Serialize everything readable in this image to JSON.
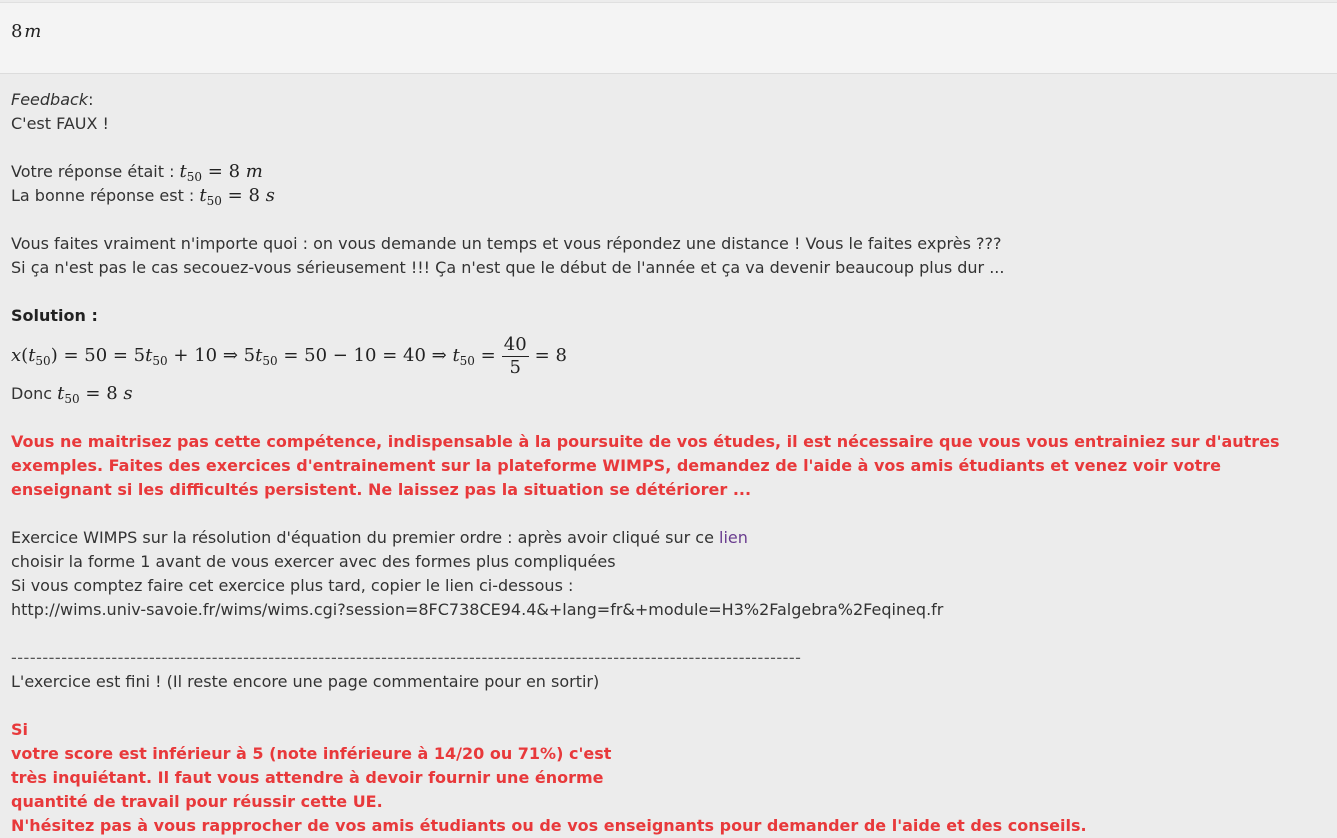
{
  "answer": {
    "value": "8",
    "unit": "m"
  },
  "feedback": {
    "label": "Feedback",
    "colon": ":",
    "verdict": "C'est FAUX !",
    "your_answer_prefix": "Votre réponse était : ",
    "correct_answer_prefix": "La bonne réponse est : ",
    "your_answer_value": "8",
    "your_answer_unit": "m",
    "correct_answer_value": "8",
    "correct_answer_unit": "s",
    "variable": "t",
    "subscript": "50",
    "comment_line1": "Vous faites vraiment n'importe quoi : on vous demande un temps et vous répondez une distance ! Vous le faites exprès ???",
    "comment_line2": "Si ça n'est pas le cas secouez-vous sérieusement !!! Ça n'est que le début de l'année et ça va devenir beaucoup plus dur ..."
  },
  "solution": {
    "title": "Solution :",
    "eq_part1": "= 50 = 5",
    "eq_part2": "+ 10 ⇒ 5",
    "eq_part3": "= 50 − 10 = 40 ⇒ ",
    "eq_part4": "= 8",
    "frac_num": "40",
    "frac_den": "5",
    "donc_prefix": "Donc ",
    "donc_value": "= 8",
    "donc_unit": "s"
  },
  "warning": {
    "text": "Vous ne maitrisez pas cette compétence, indispensable à la poursuite de vos études, il est nécessaire que vous vous entrainiez sur d'autres exemples. Faites des exercices d'entrainement sur la plateforme WIMPS, demandez de l'aide à vos amis étudiants et venez voir votre enseignant si les difficultés persistent. Ne laissez pas la situation se détériorer ..."
  },
  "exercise": {
    "line1_prefix": "Exercice WIMPS sur la résolution d'équation du premier ordre : après avoir cliqué sur ce ",
    "link_text": "lien",
    "line2": "choisir la forme 1 avant de vous exercer avec des formes plus compliquées",
    "line3": "Si vous comptez faire cet exercice plus tard, copier le lien ci-dessous :",
    "url": "http://wims.univ-savoie.fr/wims/wims.cgi?session=8FC738CE94.4&+lang=fr&+module=H3%2Falgebra%2Feqineq.fr"
  },
  "ending": {
    "divider": "------------------------------------------------------------------------------------------------------------------------------",
    "finished": "L'exercice est fini ! (Il reste encore une page commentaire pour en sortir)",
    "red_line1": "Si",
    "red_line2": "votre score est inférieur à 5 (note inférieure à 14/20 ou 71%) c'est",
    "red_line3": "très inquiétant. Il faut vous attendre à devoir fournir une énorme",
    "red_line4": "quantité de travail pour réussir cette UE.",
    "red_line5": "N'hésitez pas à vous rapprocher de vos amis étudiants ou de vos enseignants pour demander de l'aide et des conseils."
  },
  "colors": {
    "red": "#e8393b",
    "link": "#6a3d8f",
    "background": "#ececec"
  }
}
